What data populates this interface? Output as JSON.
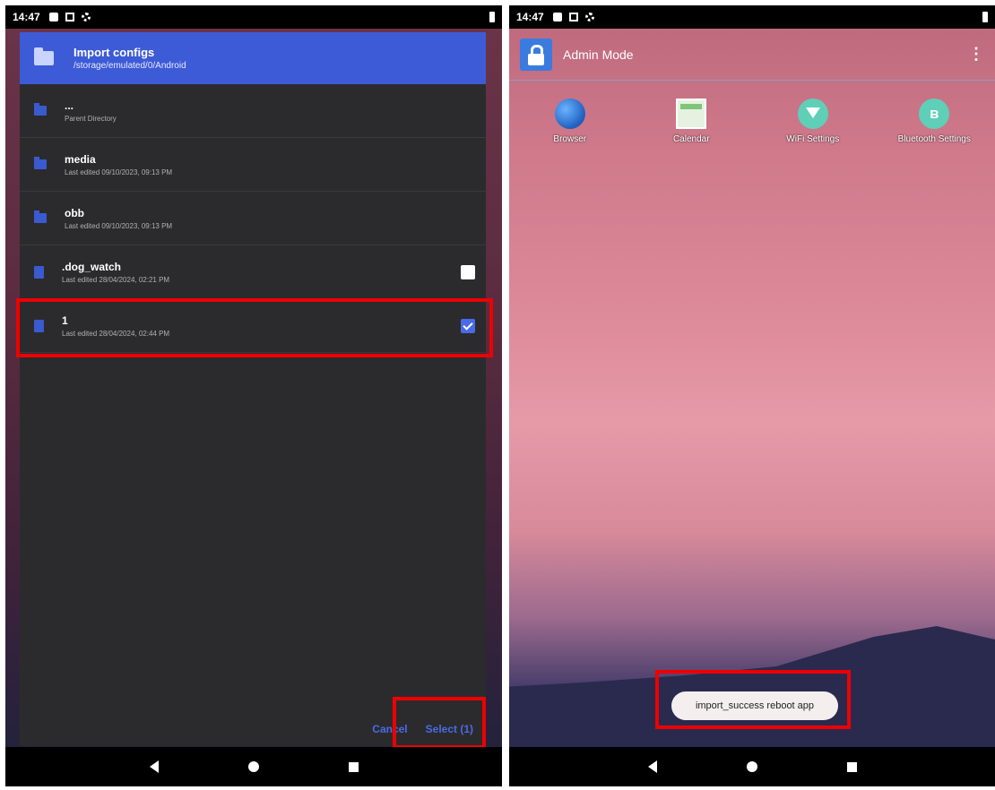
{
  "left_screen": {
    "status_time": "14:47",
    "dialog": {
      "title": "Import configs",
      "path": "/storage/emulated/0/Android",
      "rows": [
        {
          "name": "...",
          "meta": "Parent Directory"
        },
        {
          "name": "media",
          "meta": "Last edited 09/10/2023, 09:13 PM"
        },
        {
          "name": "obb",
          "meta": "Last edited 09/10/2023, 09:13 PM"
        },
        {
          "name": ".dog_watch",
          "meta": "Last edited 28/04/2024, 02:21 PM"
        },
        {
          "name": "1",
          "meta": "Last edited 28/04/2024, 02:44 PM"
        }
      ],
      "cancel_label": "Cancel",
      "select_label": "Select (1)"
    }
  },
  "right_screen": {
    "status_time": "14:47",
    "app_title": "Admin Mode",
    "overflow_icon": "⋮",
    "apps": [
      {
        "label": "Browser"
      },
      {
        "label": "Calendar"
      },
      {
        "label": "WiFi Settings"
      },
      {
        "label": "Bluetooth Settings"
      }
    ],
    "bluetooth_glyph": "ʙ",
    "toast": "import_success reboot app"
  },
  "colors": {
    "header_blue": "#3d5bd6",
    "highlight_red": "#ee0000",
    "dialog_bg": "#2b2b2d"
  }
}
